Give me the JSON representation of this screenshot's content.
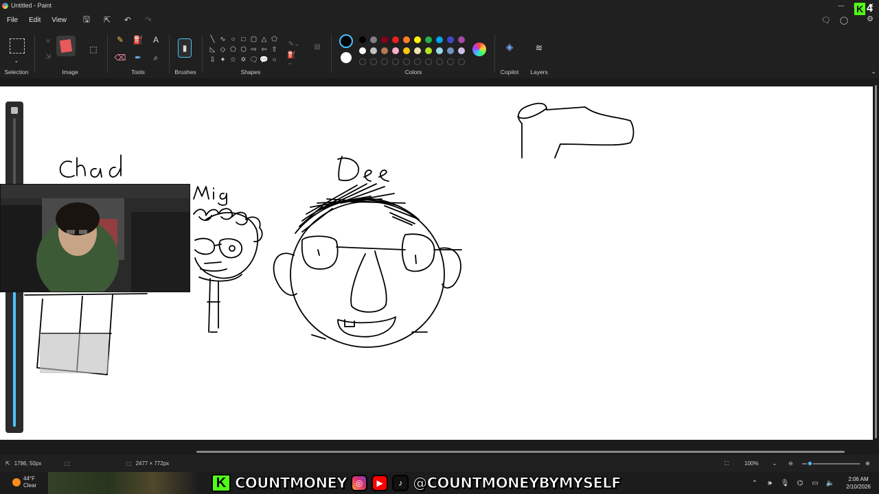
{
  "window": {
    "title": "Untitled - Paint"
  },
  "menu": {
    "file": "File",
    "edit": "Edit",
    "view": "View"
  },
  "ribbon": {
    "selection_label": "Selection",
    "image_label": "Image",
    "tools_label": "Tools",
    "brushes_label": "Brushes",
    "shapes_label": "Shapes",
    "colors_label": "Colors",
    "copilot_label": "Copilot",
    "layers_label": "Layers"
  },
  "colors": {
    "primary": "#000000",
    "secondary": "#ffffff",
    "palette_row1": [
      "#000000",
      "#7f7f7f",
      "#880015",
      "#ed1c24",
      "#ff7f27",
      "#fff200",
      "#22b14c",
      "#00a2e8",
      "#3f48cc",
      "#a349a4"
    ],
    "palette_row2": [
      "#ffffff",
      "#c3c3c3",
      "#b97a57",
      "#ffaec9",
      "#ffc90e",
      "#efe4b0",
      "#b5e61d",
      "#99d9ea",
      "#7092be",
      "#c8bfe7"
    ],
    "accent": "#4cc2ff"
  },
  "canvas": {
    "labels": {
      "chad": "Chad",
      "mig": "Mig",
      "dee": "Dee"
    }
  },
  "status": {
    "cursor_position": "1786, 50px",
    "canvas_size": "2477 × 772px",
    "zoom": "100%"
  },
  "overlay": {
    "kick_badge_count": "4",
    "streamer_name": "COUNTMONEY",
    "social_handle": "@COUNTMONEYBYMYSELF"
  },
  "taskbar": {
    "temperature": "44°F",
    "weather": "Clear",
    "time": "2:06 AM",
    "date": "2/10/2026"
  }
}
